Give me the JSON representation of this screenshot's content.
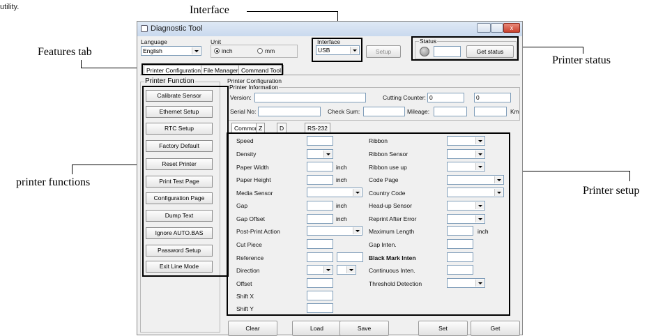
{
  "caption_fragment": "utility.",
  "annotations": {
    "interface": "Interface",
    "features_tab": "Features tab",
    "printer_status": "Printer status",
    "printer_functions": "printer functions",
    "printer_setup": "Printer setup"
  },
  "window": {
    "title": "Diagnostic Tool",
    "close_glyph": "x"
  },
  "language": {
    "label": "Language",
    "value": "English"
  },
  "unit": {
    "label": "Unit",
    "options": [
      "inch",
      "mm"
    ],
    "selected": "inch"
  },
  "interface": {
    "label": "Interface",
    "value": "USB",
    "setup_label": "Setup"
  },
  "status": {
    "label": "Status",
    "get_status_label": "Get status"
  },
  "tabs": [
    "Printer Configuration",
    "File Manager",
    "Command Tool"
  ],
  "printer_function": {
    "title": "Printer Function",
    "buttons": [
      "Calibrate Sensor",
      "Ethernet Setup",
      "RTC Setup",
      "Factory Default",
      "Reset Printer",
      "Print Test Page",
      "Configuration Page",
      "Dump Text",
      "Ignore AUTO.BAS",
      "Password Setup",
      "Exit Line Mode"
    ]
  },
  "config": {
    "title": "Printer Configuration",
    "info_title": "Printer Information",
    "version_label": "Version:",
    "cutting_counter_label": "Cutting Counter:",
    "cutting_counter_1": "0",
    "cutting_counter_2": "0",
    "serial_label": "Serial No:",
    "checksum_label": "Check Sum:",
    "mileage_label": "Mileage:",
    "km_label": "Km"
  },
  "sub_tabs": [
    "Common",
    "Z",
    "D",
    "RS-232"
  ],
  "left_params": [
    "Speed",
    "Density",
    "Paper Width",
    "Paper Height",
    "Media Sensor",
    "Gap",
    "Gap Offset",
    "Post-Print Action",
    "Cut Piece",
    "Reference",
    "Direction",
    "Offset",
    "Shift X",
    "Shift Y"
  ],
  "right_params": [
    "Ribbon",
    "Ribbon Sensor",
    "Ribbon use up",
    "Code Page",
    "Country Code",
    "Head-up Sensor",
    "Reprint After Error",
    "Maximum Length",
    "Gap Inten.",
    "Black Mark Inten",
    "Continuous Inten.",
    "Threshold Detection"
  ],
  "unit_inch": "inch",
  "bottom_buttons": [
    "Clear",
    "Load",
    "Save",
    "Set",
    "Get"
  ]
}
